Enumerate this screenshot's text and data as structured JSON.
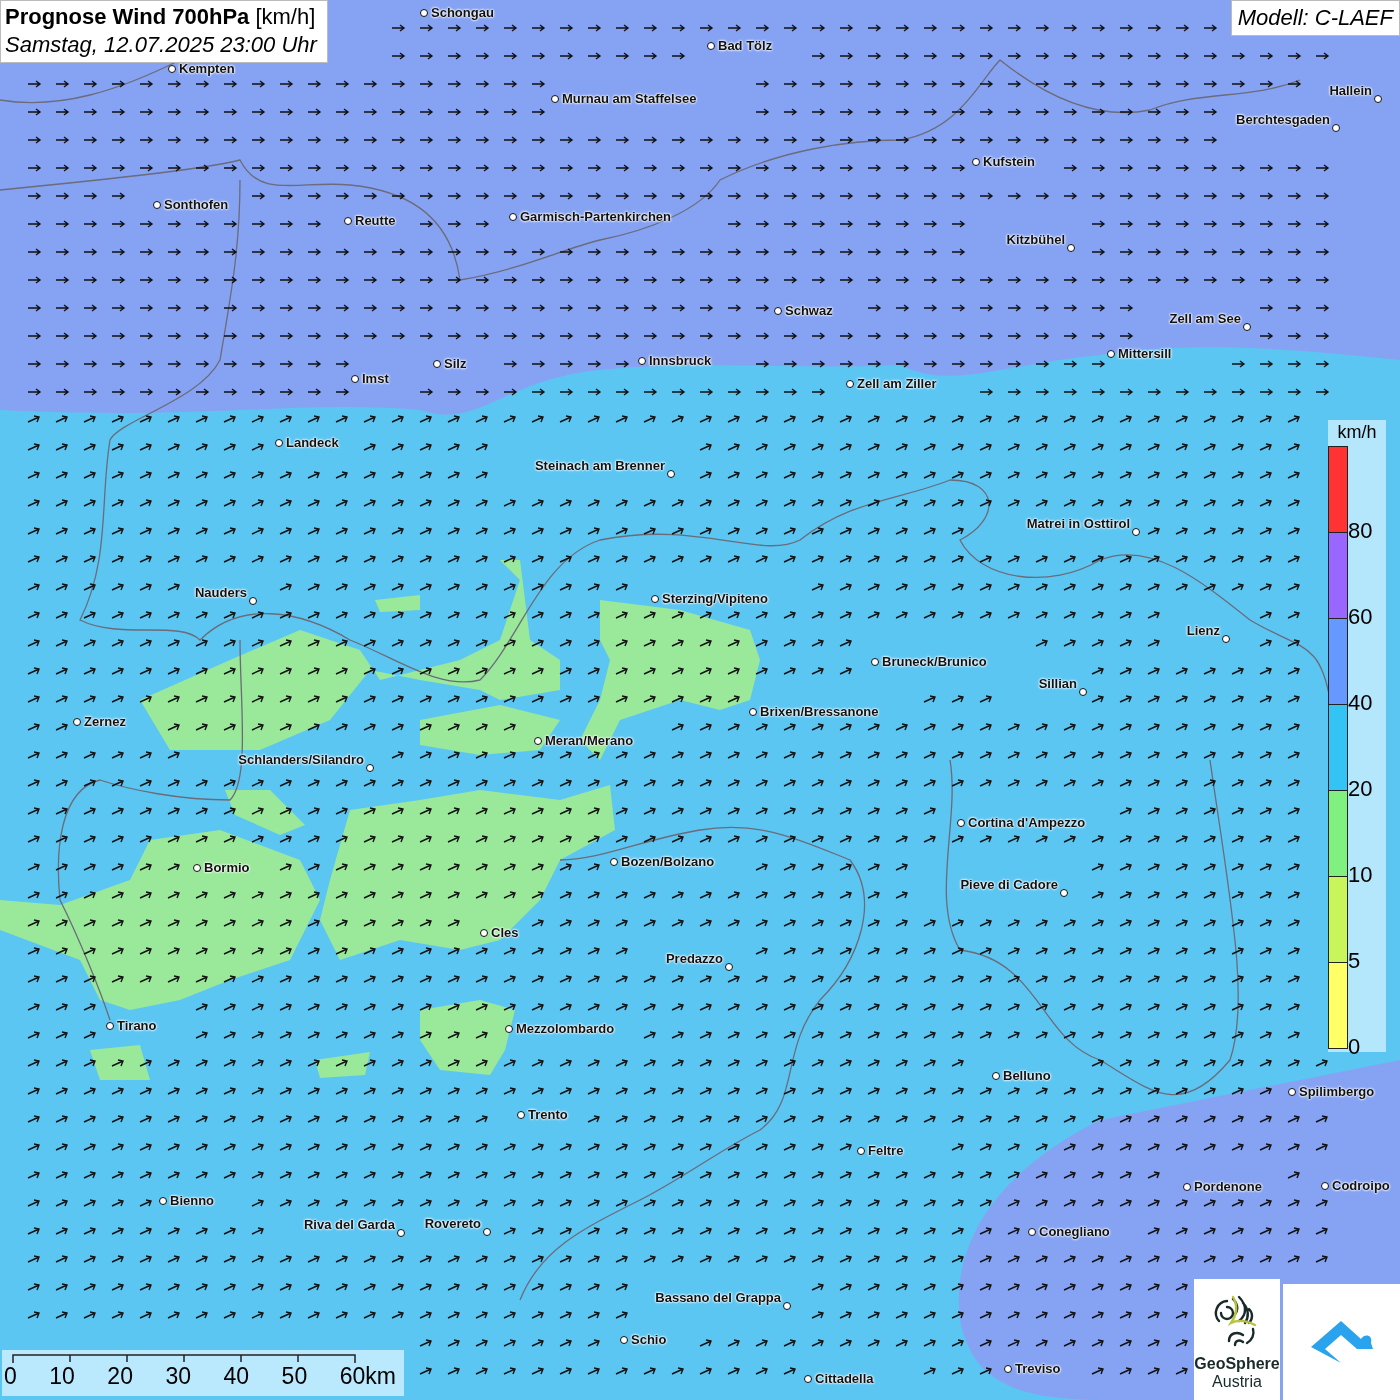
{
  "title": {
    "bold": "Prognose Wind 700hPa",
    "unit": "[km/h]",
    "subtitle": "Samstag, 12.07.2025 23:00 Uhr"
  },
  "model": "Modell: C-LAEF",
  "cities": [
    {
      "name": "Schongau"
    },
    {
      "name": "Bad Tölz"
    },
    {
      "name": "Kempten"
    },
    {
      "name": "Murnau am Staffelsee"
    },
    {
      "name": "Hallein"
    },
    {
      "name": "Berchtesgaden"
    },
    {
      "name": "Kufstein"
    },
    {
      "name": "Sonthofen"
    },
    {
      "name": "Reutte"
    },
    {
      "name": "Garmisch-Partenkirchen"
    },
    {
      "name": "Kitzbühel"
    },
    {
      "name": "Schwaz"
    },
    {
      "name": "Zell am See"
    },
    {
      "name": "Innsbruck"
    },
    {
      "name": "Mittersill"
    },
    {
      "name": "Silz"
    },
    {
      "name": "Imst"
    },
    {
      "name": "Zell am Ziller"
    },
    {
      "name": "Landeck"
    },
    {
      "name": "Steinach am Brenner"
    },
    {
      "name": "Matrei in Osttirol"
    },
    {
      "name": "Nauders"
    },
    {
      "name": "Sterzing/Vipiteno"
    },
    {
      "name": "Lienz"
    },
    {
      "name": "Bruneck/Brunico"
    },
    {
      "name": "Sillian"
    },
    {
      "name": "Brixen/Bressanone"
    },
    {
      "name": "Zernez"
    },
    {
      "name": "Meran/Merano"
    },
    {
      "name": "Schlanders/Silandro"
    },
    {
      "name": "Cortina d'Ampezzo"
    },
    {
      "name": "Bozen/Bolzano"
    },
    {
      "name": "Bormio"
    },
    {
      "name": "Pieve di Cadore"
    },
    {
      "name": "Cles"
    },
    {
      "name": "Predazzo"
    },
    {
      "name": "Tirano"
    },
    {
      "name": "Mezzolombardo"
    },
    {
      "name": "Belluno"
    },
    {
      "name": "Spilimbergo"
    },
    {
      "name": "Trento"
    },
    {
      "name": "Feltre"
    },
    {
      "name": "Pordenone"
    },
    {
      "name": "Codroipo"
    },
    {
      "name": "Bienno"
    },
    {
      "name": "Riva del Garda"
    },
    {
      "name": "Rovereto"
    },
    {
      "name": "Conegliano"
    },
    {
      "name": "Bassano del Grappa"
    },
    {
      "name": "Schio"
    },
    {
      "name": "Treviso"
    },
    {
      "name": "Cittadella"
    }
  ],
  "legend": {
    "unit": "km/h",
    "stops": [
      {
        "label": "80",
        "color": "#ff3333"
      },
      {
        "label": "60",
        "color": "#9966ff"
      },
      {
        "label": "40",
        "color": "#6699ff"
      },
      {
        "label": "20",
        "color": "#33c4f5"
      },
      {
        "label": "10",
        "color": "#80f080"
      },
      {
        "label": "5",
        "color": "#c8f55a"
      },
      {
        "label": "0",
        "color": "#ffff66"
      }
    ]
  },
  "scale": {
    "ticks": [
      "0",
      "10",
      "20",
      "30",
      "40",
      "50",
      "60km"
    ]
  },
  "logo": {
    "line1": "GeoSphere",
    "line2": "Austria"
  }
}
